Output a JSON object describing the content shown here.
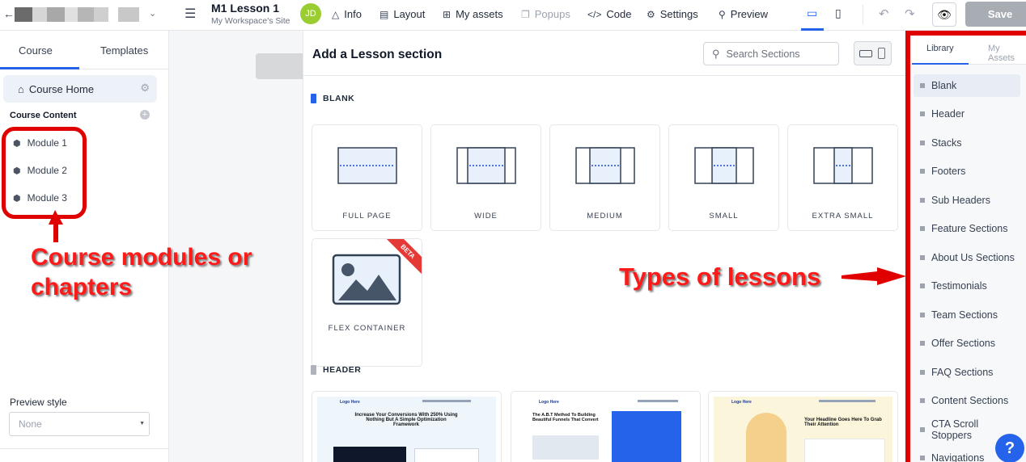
{
  "topbar": {
    "back_icon": "arrow-left-icon",
    "lesson_title": "M1 Lesson 1",
    "site_name": "My Workspace's Site",
    "avatar_initials": "JD",
    "avatar_color": "#9acd32",
    "nav": [
      {
        "label": "Info",
        "icon": "warning-triangle-icon"
      },
      {
        "label": "Layout",
        "icon": "layout-icon"
      },
      {
        "label": "My assets",
        "icon": "assets-icon"
      },
      {
        "label": "Popups",
        "icon": "popups-icon"
      },
      {
        "label": "Code",
        "icon": "code-icon"
      },
      {
        "label": "Settings",
        "icon": "settings-icon"
      },
      {
        "label": "Preview",
        "icon": "search-icon"
      }
    ],
    "save_label": "Save"
  },
  "left_panel": {
    "tabs": [
      "Course",
      "Templates"
    ],
    "active_tab": "Course",
    "course_home": "Course Home",
    "course_content_label": "Course Content",
    "modules": [
      "Module 1",
      "Module 2",
      "Module 3"
    ],
    "preview_style_label": "Preview style",
    "preview_style_value": "None"
  },
  "modal": {
    "title": "Add a Lesson section",
    "search_placeholder": "Search Sections",
    "sections": [
      {
        "name": "BLANK",
        "marker_color": "#2563eb"
      },
      {
        "name": "HEADER",
        "marker_color": "#b0b4ba"
      }
    ],
    "blank_cards": [
      "FULL PAGE",
      "WIDE",
      "MEDIUM",
      "SMALL",
      "EXTRA SMALL"
    ],
    "flex_card": {
      "label": "FLEX CONTAINER",
      "badge": "BETA"
    },
    "header_templates": [
      {
        "logo": "Logo Here",
        "headline": "Increase Your Conversions With 250% Using Nothing But A Simple Optimization Framework"
      },
      {
        "logo": "Logo Here",
        "headline": "The A.B.T Method To Building Beautiful Funnels That Convert"
      },
      {
        "logo": "Logo Here",
        "headline": "Your Headline Goes Here To Grab Their Attention"
      }
    ]
  },
  "right_panel": {
    "tabs": [
      "Library",
      "My Assets"
    ],
    "active_tab": "Library",
    "items": [
      "Blank",
      "Header",
      "Stacks",
      "Footers",
      "Sub Headers",
      "Feature Sections",
      "About Us Sections",
      "Testimonials",
      "Team Sections",
      "Offer Sections",
      "FAQ Sections",
      "Content Sections",
      "CTA Scroll Stoppers",
      "Navigations"
    ],
    "active_item": "Blank"
  },
  "annotations": {
    "left_line1": "Course modules or",
    "left_line2": "chapters",
    "right": "Types of lessons",
    "color": "#ff1a1a"
  },
  "help_icon": "question-mark-icon"
}
